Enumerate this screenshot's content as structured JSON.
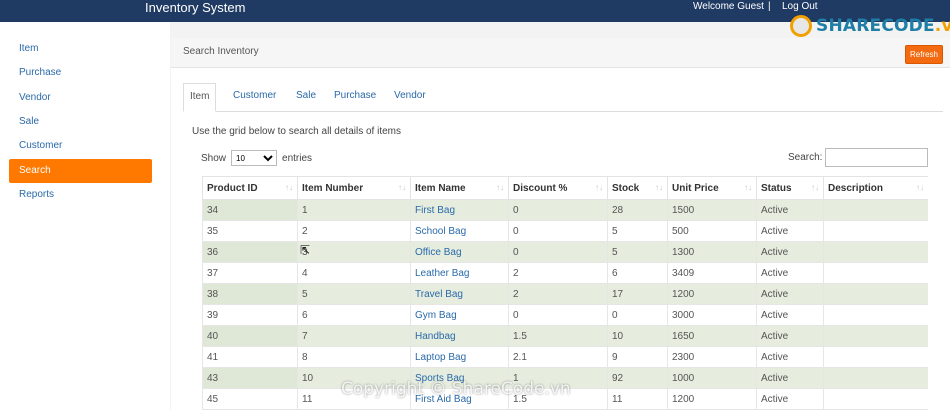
{
  "topbar": {
    "brand": "Inventory System",
    "welcome": "Welcome Guest",
    "separator": "|",
    "logout": "Log Out"
  },
  "watermark": {
    "logo_main": "SHARECODE",
    "logo_tld": ".vn",
    "overlay": "ShareCode.vn",
    "copyright": "Copyright © ShareCode.vn"
  },
  "sidebar": {
    "items": [
      {
        "label": "Item"
      },
      {
        "label": "Purchase"
      },
      {
        "label": "Vendor"
      },
      {
        "label": "Sale"
      },
      {
        "label": "Customer"
      },
      {
        "label": "Search",
        "active": true
      },
      {
        "label": "Reports"
      }
    ]
  },
  "panel": {
    "title": "Search Inventory",
    "refresh_label": "Refresh"
  },
  "tabs": [
    {
      "label": "Item",
      "active": true
    },
    {
      "label": "Customer"
    },
    {
      "label": "Sale"
    },
    {
      "label": "Purchase"
    },
    {
      "label": "Vendor"
    }
  ],
  "grid": {
    "description": "Use the grid below to search all details of items",
    "show_label": "Show",
    "entries_label": "entries",
    "page_size": "10",
    "search_label": "Search:",
    "search_value": "",
    "columns": [
      "Product ID",
      "Item Number",
      "Item Name",
      "Discount %",
      "Stock",
      "Unit Price",
      "Status",
      "Description"
    ],
    "rows": [
      [
        "34",
        "1",
        "First Bag",
        "0",
        "28",
        "1500",
        "Active",
        ""
      ],
      [
        "35",
        "2",
        "School Bag",
        "0",
        "5",
        "500",
        "Active",
        ""
      ],
      [
        "36",
        "3",
        "Office Bag",
        "0",
        "5",
        "1300",
        "Active",
        ""
      ],
      [
        "37",
        "4",
        "Leather Bag",
        "2",
        "6",
        "3409",
        "Active",
        ""
      ],
      [
        "38",
        "5",
        "Travel Bag",
        "2",
        "17",
        "1200",
        "Active",
        ""
      ],
      [
        "39",
        "6",
        "Gym Bag",
        "0",
        "0",
        "3000",
        "Active",
        ""
      ],
      [
        "40",
        "7",
        "Handbag",
        "1.5",
        "10",
        "1650",
        "Active",
        ""
      ],
      [
        "41",
        "8",
        "Laptop Bag",
        "2.1",
        "9",
        "2300",
        "Active",
        ""
      ],
      [
        "43",
        "10",
        "Sports Bag",
        "1",
        "92",
        "1000",
        "Active",
        ""
      ],
      [
        "45",
        "11",
        "First Aid Bag",
        "1.5",
        "11",
        "1200",
        "Active",
        ""
      ]
    ]
  },
  "colors": {
    "topbar": "#1f3a63",
    "accent": "#ff7800",
    "link": "#2a6aa9",
    "row_stripe": "#e6eddf"
  }
}
